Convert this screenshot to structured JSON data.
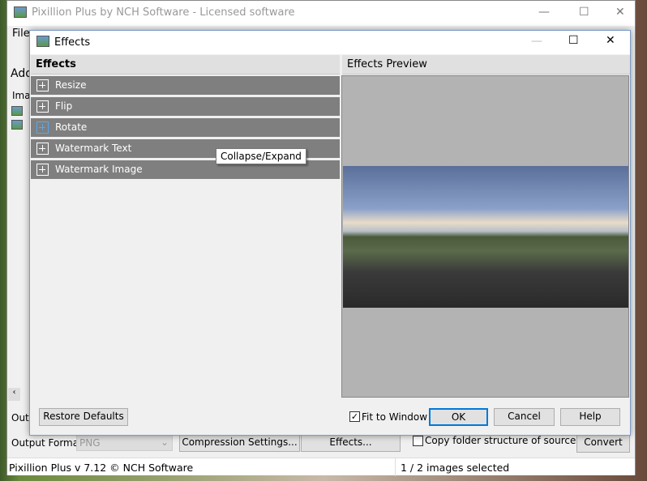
{
  "main_window": {
    "title": "Pixillion Plus by NCH Software - Licensed software",
    "menu_file": "File",
    "add_partial": "Add",
    "images_partial": "Imag",
    "output_partial": "Outp",
    "output_format_label": "Output Format:",
    "output_format_value": "PNG",
    "compression_button": "Compression Settings...",
    "effects_button": "Effects...",
    "copy_folder_label": "Copy folder structure of source files",
    "convert_button": "Convert",
    "status_left": "Pixillion Plus v 7.12 © NCH Software",
    "status_right": "1 / 2 images selected"
  },
  "dialog": {
    "title": "Effects",
    "effects_header": "Effects",
    "preview_header": "Effects Preview",
    "effects": [
      {
        "label": "Resize"
      },
      {
        "label": "Flip"
      },
      {
        "label": "Rotate"
      },
      {
        "label": "Watermark Text"
      },
      {
        "label": "Watermark Image"
      }
    ],
    "tooltip": "Collapse/Expand",
    "restore_defaults": "Restore Defaults",
    "fit_to_window": "Fit to Window",
    "fit_to_window_checked": true,
    "ok": "OK",
    "cancel": "Cancel",
    "help": "Help"
  }
}
